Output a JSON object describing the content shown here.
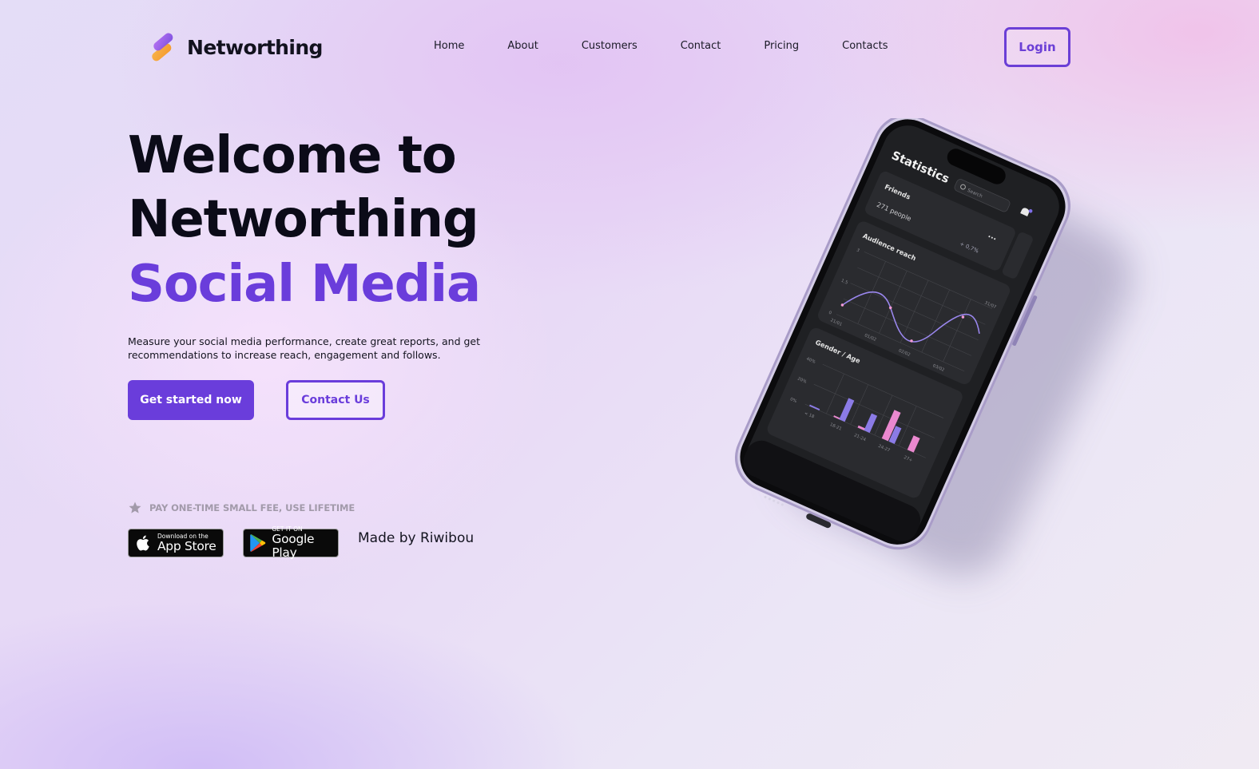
{
  "brand": {
    "name": "Networthing"
  },
  "nav": {
    "items": [
      "Home",
      "About",
      "Customers",
      "Contact",
      "Pricing",
      "Contacts"
    ]
  },
  "header": {
    "login_label": "Login"
  },
  "hero": {
    "line1": "Welcome to",
    "line2": "Networthing",
    "line3": "Social Media",
    "description": "Measure your social media performance, create great reports, and get recommendations to increase reach, engagement and follows.",
    "primary_cta": "Get started now",
    "secondary_cta": "Contact Us"
  },
  "promo": {
    "fee_text": "PAY ONE-TIME SMALL FEE, USE LIFETIME"
  },
  "stores": {
    "appstore_small": "Download on the",
    "appstore_big": "App Store",
    "gplay_small": "GET IT ON",
    "gplay_big": "Google Play"
  },
  "credit": {
    "made_by": "Made by Riwibou"
  },
  "phone_screen": {
    "title": "Statistics",
    "search_placeholder": "Search",
    "friends_label": "Friends",
    "friends_count": "271 people",
    "friends_change": "+ 0,7%",
    "audience_title": "Audience reach",
    "audience_y": [
      "3",
      "1.5",
      "0"
    ],
    "audience_x": [
      "21/01",
      "01/02",
      "02/02",
      "03/02"
    ],
    "audience_corner": "31/07",
    "gender_title": "Gender / Age",
    "gender_y": [
      "40%",
      "20%",
      "0%"
    ],
    "gender_x": [
      "< 18",
      "18-21",
      "21-24",
      "24-27",
      "27+"
    ]
  },
  "colors": {
    "accent": "#6a3ddb",
    "dark": "#0b0b18",
    "muted": "#a29aaa"
  }
}
